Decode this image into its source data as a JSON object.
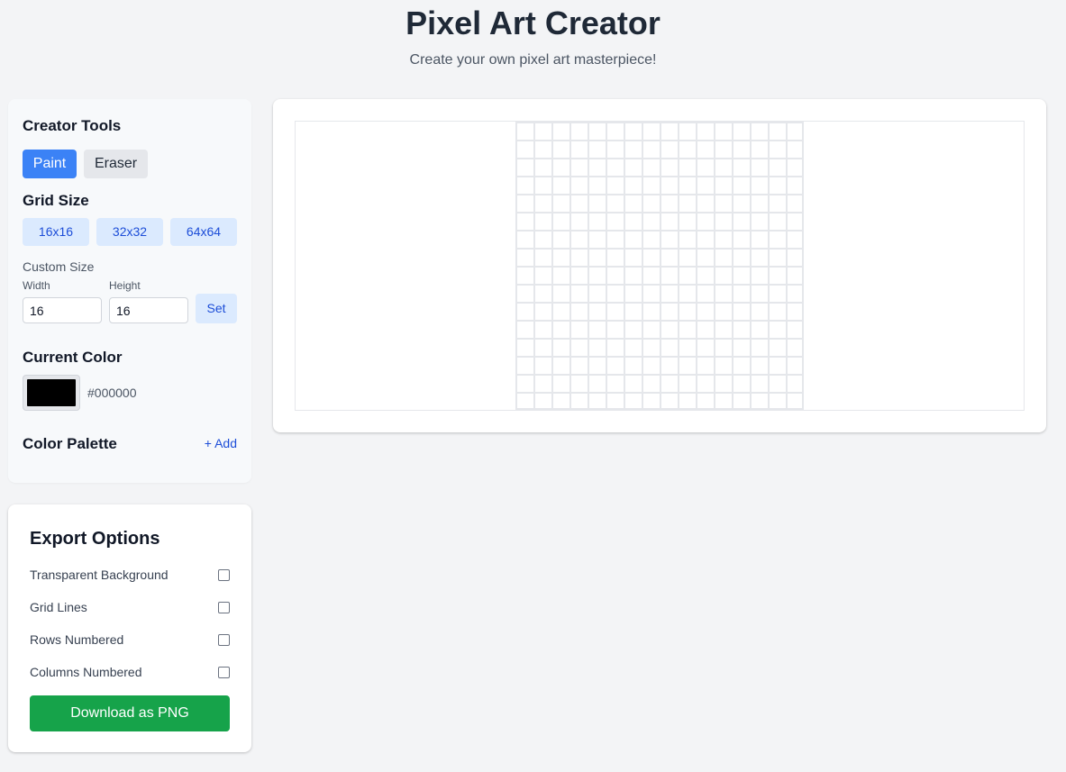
{
  "header": {
    "title": "Pixel Art Creator",
    "subtitle": "Create your own pixel art masterpiece!"
  },
  "tools": {
    "title": "Creator Tools",
    "paint_label": "Paint",
    "eraser_label": "Eraser",
    "active_tool": "Paint",
    "grid_size_title": "Grid Size",
    "presets": [
      "16x16",
      "32x32",
      "64x64"
    ],
    "custom_size_label": "Custom Size",
    "width_label": "Width",
    "height_label": "Height",
    "width_value": "16",
    "height_value": "16",
    "set_label": "Set",
    "current_color_title": "Current Color",
    "current_color": "#000000",
    "palette_title": "Color Palette",
    "add_label": "+ Add"
  },
  "export": {
    "title": "Export Options",
    "options": [
      {
        "label": "Transparent Background",
        "checked": false
      },
      {
        "label": "Grid Lines",
        "checked": false
      },
      {
        "label": "Rows Numbered",
        "checked": false
      },
      {
        "label": "Columns Numbered",
        "checked": false
      }
    ],
    "download_label": "Download as PNG"
  },
  "canvas": {
    "columns": 16,
    "rows": 16
  },
  "colors": {
    "primary": "#3b82f6",
    "download": "#16a34a",
    "preset_bg": "#dbeafe",
    "preset_text": "#1d4ed8"
  }
}
